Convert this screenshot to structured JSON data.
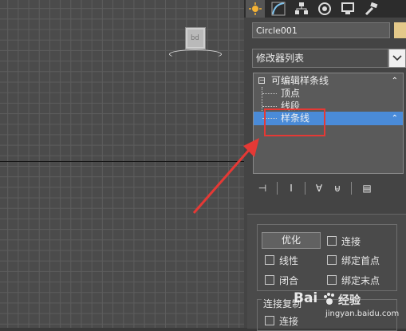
{
  "toolbar": {
    "tabs": [
      "create-icon",
      "modify-icon",
      "hierarchy-icon",
      "motion-icon",
      "display-icon",
      "utilities-icon"
    ]
  },
  "object": {
    "name": "Circle001",
    "color": "#e4c98a",
    "icon_label": "bd"
  },
  "modifier_list": {
    "label": "修改器列表"
  },
  "stack": {
    "root": "可编辑样条线",
    "items": [
      {
        "label": "顶点",
        "selected": false
      },
      {
        "label": "线段",
        "selected": false
      },
      {
        "label": "样条线",
        "selected": true
      }
    ]
  },
  "rollout": {
    "weld_button": "优化",
    "checks": [
      "连接",
      "线性",
      "绑定首点",
      "闭合",
      "绑定末点"
    ],
    "connect_copy": {
      "title": "连接复制",
      "check": "连接"
    }
  },
  "watermark": {
    "brand": "Bai",
    "brand2": "经验",
    "url": "jingyan.baidu.com"
  },
  "colors": {
    "selection": "#4a8bd8",
    "annotation": "#e53935"
  }
}
